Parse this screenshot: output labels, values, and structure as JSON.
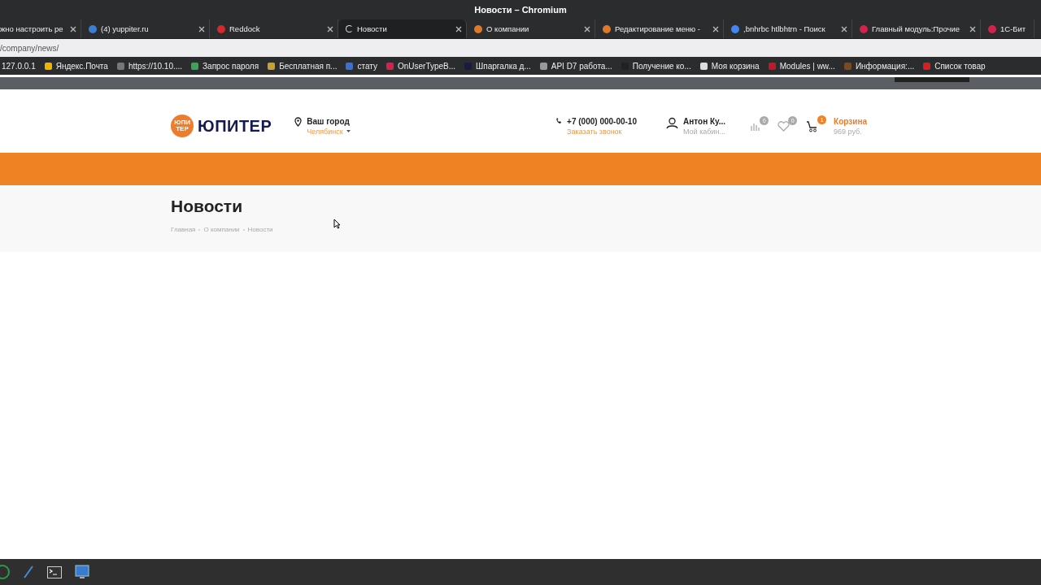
{
  "window": {
    "title": "Новости – Chromium"
  },
  "tabs": [
    {
      "label": "жно настроить ре",
      "selected": false
    },
    {
      "label": "(4) yuppiter.ru",
      "selected": false,
      "color": "#3b7fd4"
    },
    {
      "label": "Reddock",
      "selected": false,
      "color": "#d42a2a"
    },
    {
      "label": "Новости",
      "selected": true
    },
    {
      "label": "О компании",
      "selected": false,
      "color": "#e0782a"
    },
    {
      "label": "Редактирование меню -",
      "selected": false,
      "color": "#e0782a"
    },
    {
      "label": ",bnhrbc htlbhtrn - Поиск",
      "selected": false,
      "color": "#4285f4"
    },
    {
      "label": "Главный модуль:Прочие",
      "selected": false,
      "color": "#d4234a"
    },
    {
      "label": "1С-Бит",
      "selected": false,
      "color": "#d4234a"
    }
  ],
  "address": {
    "value": "/company/news/"
  },
  "bookmarks": [
    {
      "label": "127.0.0.1"
    },
    {
      "label": "Яндекс.Почта",
      "color": "#f0b400"
    },
    {
      "label": "https://10.10....",
      "color": "#777777"
    },
    {
      "label": "Запрос пароля",
      "color": "#3aa655"
    },
    {
      "label": "Бесплатная п...",
      "color": "#c8a030"
    },
    {
      "label": "стату",
      "color": "#3a6fd8"
    },
    {
      "label": "OnUserTypeB...",
      "color": "#d4234a"
    },
    {
      "label": "Шпаргалка д...",
      "color": "#1a1a4a"
    },
    {
      "label": "API D7 работа...",
      "color": "#999999"
    },
    {
      "label": "Получение ко...",
      "color": "#222222"
    },
    {
      "label": "Моя корзина",
      "color": "#dddddd"
    },
    {
      "label": "Modules | ww...",
      "color": "#c0182a"
    },
    {
      "label": "Информация:...",
      "color": "#7a4a20"
    },
    {
      "label": "Список товар",
      "color": "#d42020"
    }
  ],
  "site": {
    "logo_mark": [
      "ЮПИ",
      "ТЕР"
    ],
    "logo_text": "ЮПИТЕР",
    "city_label": "Ваш город",
    "city": "Челябинск",
    "phone": "+7 (000) 000-00-10",
    "callback": "Заказать звонок",
    "user_name": "Антон Ку...",
    "user_sub": "Мой кабин...",
    "counters": [
      {
        "kind": "compare",
        "badge": "0",
        "color": "#aaaaaa"
      },
      {
        "kind": "favorite",
        "badge": "0",
        "color": "#aaaaaa"
      },
      {
        "kind": "cart",
        "badge": "1",
        "color": "#f08223"
      }
    ],
    "cart_label": "Корзина",
    "cart_sum": "969 руб."
  },
  "page": {
    "title": "Новости",
    "breadcrumbs": [
      "Главная",
      "О компании",
      "Новости"
    ]
  }
}
